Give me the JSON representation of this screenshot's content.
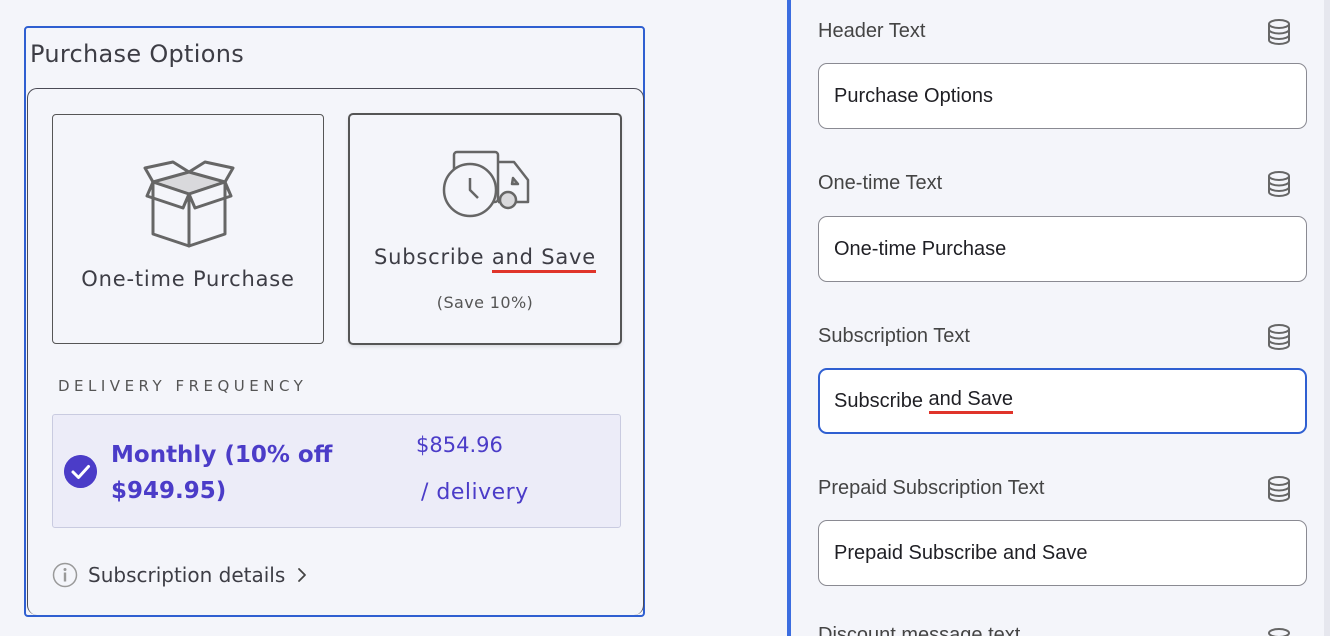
{
  "preview": {
    "title": "Purchase Options",
    "options": [
      {
        "label": "One-time Purchase",
        "icon": "box-icon"
      },
      {
        "label_start": "Subscribe ",
        "label_underlined": "and Save",
        "sub": "(Save 10%)",
        "icon": "delivery-truck-clock-icon"
      }
    ],
    "delivery_frequency_label": "DELIVERY FREQUENCY",
    "frequency": {
      "name": "Monthly (10% off $949.95)",
      "price": "$854.96",
      "per": "/ delivery"
    },
    "details_link": "Subscription details"
  },
  "panel": {
    "fields": [
      {
        "label": "Header Text",
        "value": "Purchase Options"
      },
      {
        "label": "One-time Text",
        "value": "One-time Purchase"
      },
      {
        "label": "Subscription Text",
        "value_start": "Subscribe ",
        "value_underlined": "and Save"
      },
      {
        "label": "Prepaid Subscription Text",
        "value": "Prepaid Subscribe and Save"
      },
      {
        "label": "Discount message text"
      }
    ]
  },
  "colors": {
    "accent": "#2f5fd1",
    "purple": "#4b3cc8",
    "spellcheck": "#e0342a"
  }
}
